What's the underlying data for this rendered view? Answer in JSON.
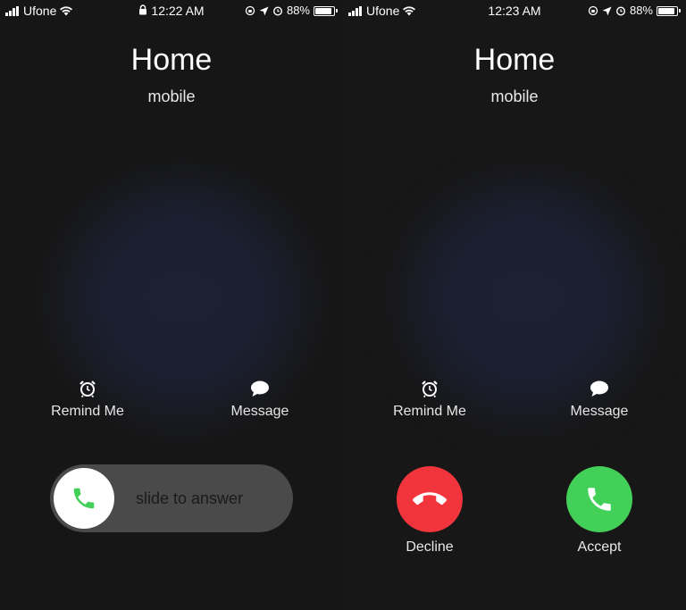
{
  "left_screen": {
    "status": {
      "carrier": "Ufone",
      "time": "12:22 AM",
      "battery": "88%",
      "battery_level": 0.88
    },
    "caller": "Home",
    "label": "mobile",
    "actions": [
      {
        "label": "Remind Me",
        "icon": "alarm-clock-icon"
      },
      {
        "label": "Message",
        "icon": "speech-bubble-icon"
      }
    ],
    "slider_text": "slide to answer"
  },
  "right_screen": {
    "status": {
      "carrier": "Ufone",
      "time": "12:23 AM",
      "battery": "88%",
      "battery_level": 0.88
    },
    "caller": "Home",
    "label": "mobile",
    "actions": [
      {
        "label": "Remind Me",
        "icon": "alarm-clock-icon"
      },
      {
        "label": "Message",
        "icon": "speech-bubble-icon"
      }
    ],
    "decline_label": "Decline",
    "accept_label": "Accept"
  },
  "colors": {
    "background": "#161616",
    "decline": "#f2353c",
    "accept": "#43d058",
    "slider_track": "#4a4a4a"
  }
}
